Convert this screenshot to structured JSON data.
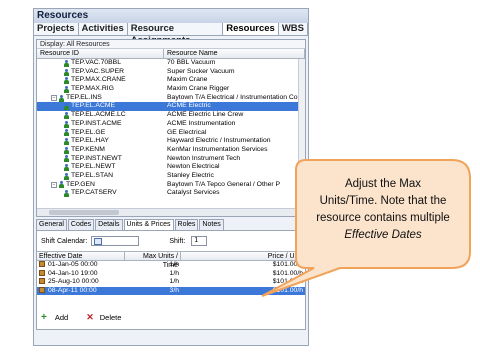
{
  "window": {
    "title": "Resources",
    "tabs": [
      "Projects",
      "Activities",
      "Resource Assignments",
      "Resources",
      "WBS"
    ],
    "active_tab": "Resources"
  },
  "resources": {
    "display_label": "Display: All Resources",
    "columns": [
      "Resource ID",
      "Resource Name"
    ],
    "rows": [
      {
        "id": "TEP.VAC.70BBL",
        "name": "70 BBL Vacuum"
      },
      {
        "id": "TEP.VAC.SUPER",
        "name": "Super Sucker Vacuum"
      },
      {
        "id": "TEP.MAX.CRANE",
        "name": "Maxim Crane"
      },
      {
        "id": "TEP.MAX.RIG",
        "name": "Maxim Crane Rigger"
      },
      {
        "id": "TEP.EL.INS",
        "name": "Baytown T/A Electrical / Instrumentation Contractors"
      },
      {
        "id": "TEP.EL.ACME",
        "name": "ACME Electric"
      },
      {
        "id": "TEP.EL.ACME.LC",
        "name": "ACME Electric Line Crew"
      },
      {
        "id": "TEP.INST.ACME",
        "name": "ACME Instrumentation"
      },
      {
        "id": "TEP.EL.GE",
        "name": "GE Electrical"
      },
      {
        "id": "TEP.EL.HAY",
        "name": "Hayward Electric / Instrumentation"
      },
      {
        "id": "TEP.KENM",
        "name": "KenMar Instrumentation Services"
      },
      {
        "id": "TEP.INST.NEWT",
        "name": "Newton Instrument Tech"
      },
      {
        "id": "TEP.EL.NEWT",
        "name": "Newton Electrical"
      },
      {
        "id": "TEP.EL.STAN",
        "name": "Stanley Electric"
      },
      {
        "id": "TEP.GEN",
        "name": "Baytown T/A Tepco General / Other P"
      },
      {
        "id": "TEP.CATSERV",
        "name": "Catalyst Services"
      }
    ],
    "selected_index": 5
  },
  "detail_tabs": [
    "General",
    "Codes",
    "Details",
    "Units & Prices",
    "Roles",
    "Notes"
  ],
  "active_detail_tab": "Units & Prices",
  "shift_calendar_label": "Shift Calendar:",
  "shift_label": "Shift:",
  "shift_value": "1",
  "grid": {
    "columns": [
      "Effective Date",
      "Max Units / Time",
      "Price / Unit"
    ],
    "rows": [
      {
        "date": "01-Jan-05 00:00",
        "units": "1/h",
        "price": "$101.00/h"
      },
      {
        "date": "04-Jan-10 19:00",
        "units": "1/h",
        "price": "$101.00/h"
      },
      {
        "date": "25-Aug-10 00:00",
        "units": "1/h",
        "price": "$101.00/h"
      },
      {
        "date": "08-Apr-11 00:00",
        "units": "3/h",
        "price": "$101.00/h"
      }
    ],
    "selected_index": 3
  },
  "buttons": {
    "add": "Add",
    "delete": "Delete"
  },
  "callout": {
    "line1": "Adjust the Max",
    "line2": "Units/Time. Note that the",
    "line3": "resource contains multiple",
    "line4": "Effective Dates"
  },
  "colors": {
    "selection": "#3b78d8",
    "callout_fill": "#fbe3cc",
    "callout_border": "#f1a35a"
  }
}
